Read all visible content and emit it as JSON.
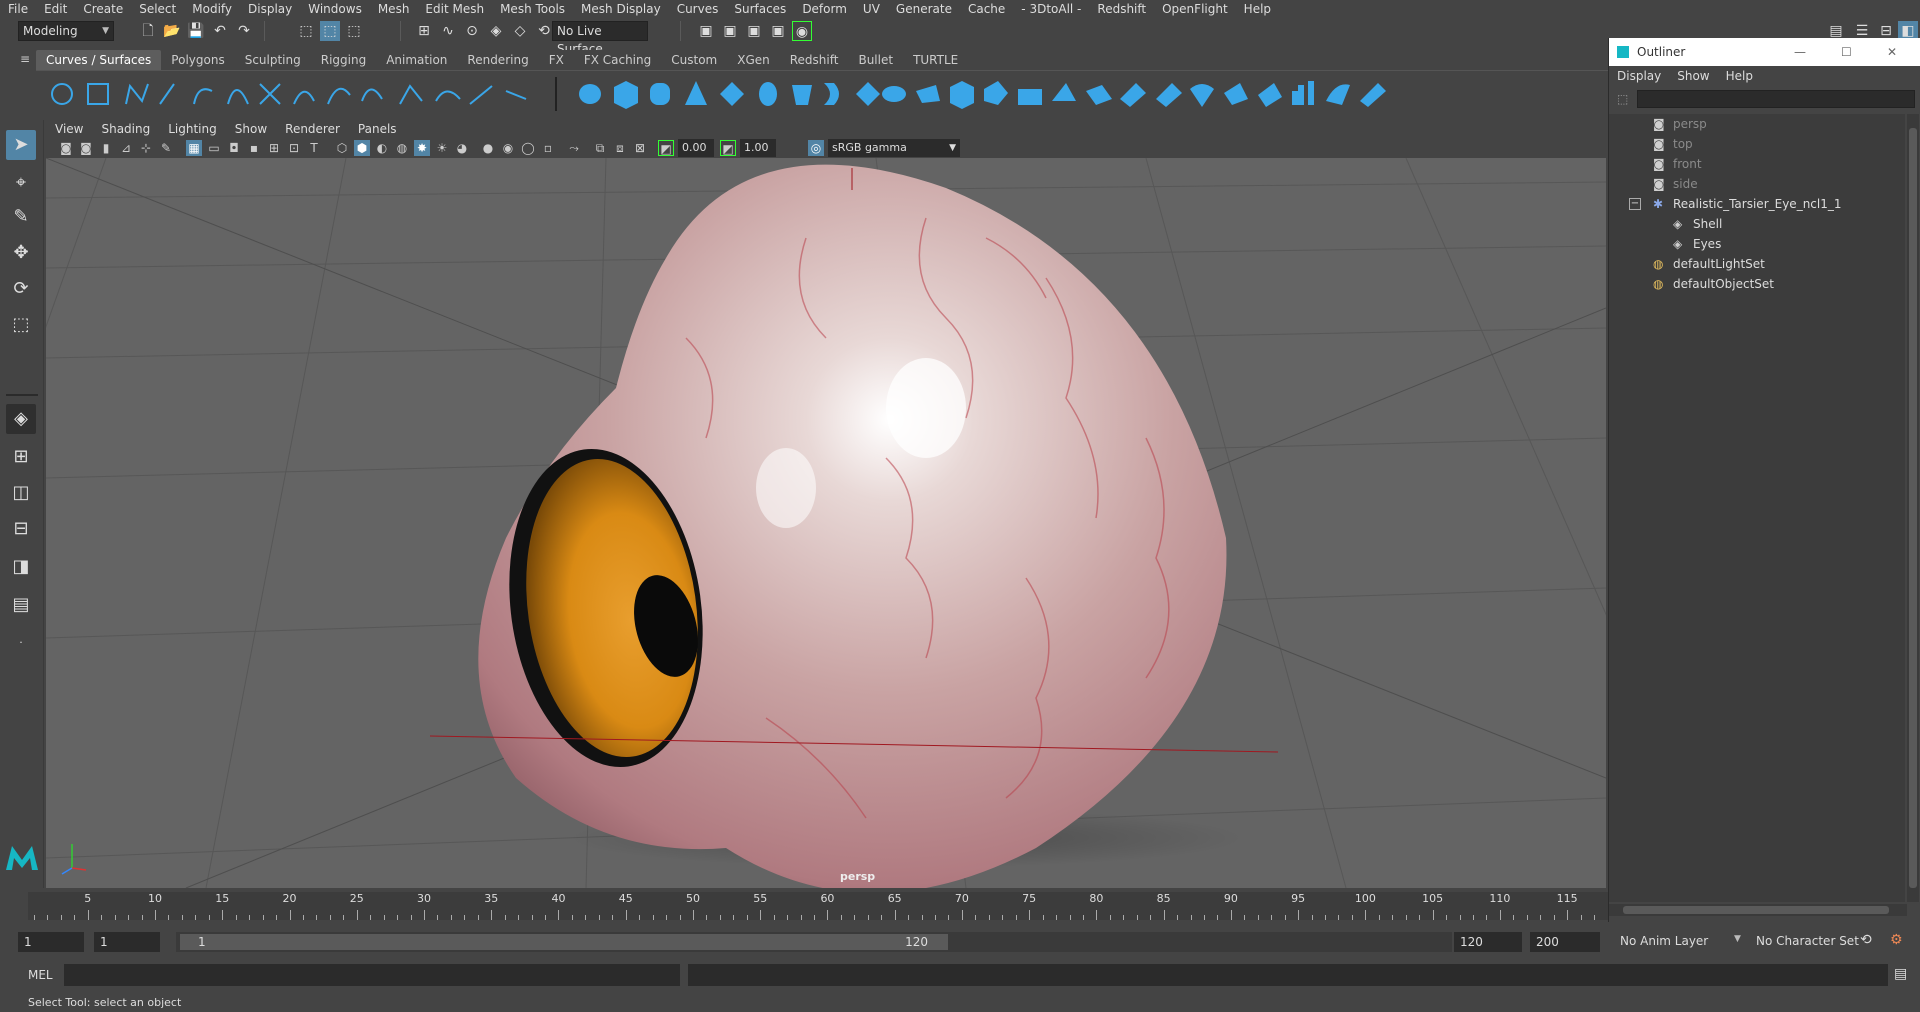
{
  "menubar": {
    "items": [
      "File",
      "Edit",
      "Create",
      "Select",
      "Modify",
      "Display",
      "Windows",
      "Mesh",
      "Edit Mesh",
      "Mesh Tools",
      "Mesh Display",
      "Curves",
      "Surfaces",
      "Deform",
      "UV",
      "Generate",
      "Cache",
      "- 3DtoAll -",
      "Redshift",
      "OpenFlight",
      "Help"
    ]
  },
  "statusline": {
    "workspace": "Modeling",
    "live_surface": "No Live Surface"
  },
  "shelf": {
    "tabs": [
      "Curves / Surfaces",
      "Polygons",
      "Sculpting",
      "Rigging",
      "Animation",
      "Rendering",
      "FX",
      "FX Caching",
      "Custom",
      "XGen",
      "Redshift",
      "Bullet",
      "TURTLE"
    ],
    "active_tab": "Curves / Surfaces"
  },
  "panel": {
    "menus": [
      "View",
      "Shading",
      "Lighting",
      "Show",
      "Renderer",
      "Panels"
    ],
    "exposure": "0.00",
    "gamma": "1.00",
    "color_space": "sRGB gamma",
    "camera_label": "persp"
  },
  "outliner": {
    "title": "Outliner",
    "menus": [
      "Display",
      "Show",
      "Help"
    ],
    "items": [
      {
        "label": "persp",
        "dim": true
      },
      {
        "label": "top",
        "dim": true
      },
      {
        "label": "front",
        "dim": true
      },
      {
        "label": "side",
        "dim": true
      },
      {
        "label": "Realistic_Tarsier_Eye_ncl1_1",
        "dim": false
      },
      {
        "label": "Shell",
        "dim": false
      },
      {
        "label": "Eyes",
        "dim": false
      },
      {
        "label": "defaultLightSet",
        "dim": false
      },
      {
        "label": "defaultObjectSet",
        "dim": false
      }
    ]
  },
  "timeline": {
    "ticks": [
      "5",
      "10",
      "15",
      "20",
      "25",
      "30",
      "35",
      "40",
      "45",
      "50",
      "55",
      "60",
      "65",
      "70",
      "75",
      "80",
      "85",
      "90",
      "95",
      "100",
      "105",
      "110",
      "115"
    ],
    "current_frame": "1"
  },
  "range": {
    "start_frame": "1",
    "playback_start": "1",
    "slider_start": "1",
    "slider_end": "120",
    "playback_end": "120",
    "end_frame": "200",
    "anim_layer": "No Anim Layer",
    "character_set": "No Character Set"
  },
  "cmdline": {
    "label": "MEL"
  },
  "helpline": {
    "text": "Select Tool: select an object"
  },
  "colors": {
    "accent": "#5285a6",
    "iris": "#d98a14",
    "sclera": "#d9b8b8"
  }
}
